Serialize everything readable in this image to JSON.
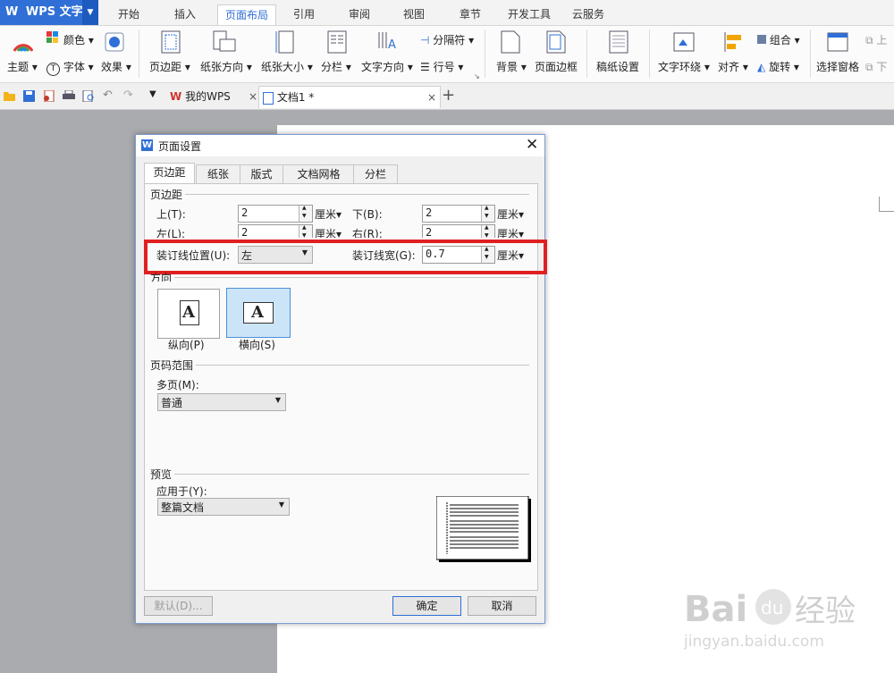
{
  "app": {
    "logo": "W",
    "title": "WPS 文字",
    "dropdown_icon": "triangle-down-icon"
  },
  "menu_tabs": [
    "开始",
    "插入",
    "页面布局",
    "引用",
    "审阅",
    "视图",
    "章节",
    "开发工具",
    "云服务"
  ],
  "active_tab": "页面布局",
  "ribbon": {
    "theme": "主题",
    "color": "颜色",
    "font": "字体",
    "effect": "效果",
    "margins": "页边距",
    "orientation": "纸张方向",
    "size": "纸张大小",
    "columns": "分栏",
    "text_direction": "文字方向",
    "breaks": "分隔符",
    "line_numbers": "行号",
    "background": "背景",
    "page_border": "页面边框",
    "manuscript": "稿纸设置",
    "wrap_text": "文字环绕",
    "align": "对齐",
    "group": "组合",
    "rotate": "旋转",
    "selection_pane": "选择窗格",
    "bring_up": "上",
    "send_down": "下"
  },
  "quickbar": {
    "tab_my_wps": "我的WPS",
    "tab_doc": "文档1 *"
  },
  "dialog": {
    "title": "页面设置",
    "tabs": [
      "页边距",
      "纸张",
      "版式",
      "文档网格",
      "分栏"
    ],
    "section_margins": "页边距",
    "top_label": "上(T):",
    "top_value": "2",
    "bottom_label": "下(B):",
    "bottom_value": "2",
    "left_label": "左(L):",
    "left_value": "2",
    "right_label": "右(R):",
    "right_value": "2",
    "unit": "厘米",
    "gutter_pos_label": "装订线位置(U):",
    "gutter_pos_value": "左",
    "gutter_width_label": "装订线宽(G):",
    "gutter_width_value": "0.7",
    "section_orientation": "方向",
    "portrait": "纵向(P)",
    "landscape": "横向(S)",
    "orientation_glyph": "A",
    "section_pages": "页码范围",
    "multi_pages_label": "多页(M):",
    "multi_pages_value": "普通",
    "section_preview": "预览",
    "apply_to_label": "应用于(Y):",
    "apply_to_value": "整篇文档",
    "default_button": "默认(D)...",
    "ok_button": "确定",
    "cancel_button": "取消"
  },
  "highlight_color": "#e02020",
  "watermark": {
    "brand": "Baidu经验",
    "url": "jingyan.baidu.com"
  }
}
